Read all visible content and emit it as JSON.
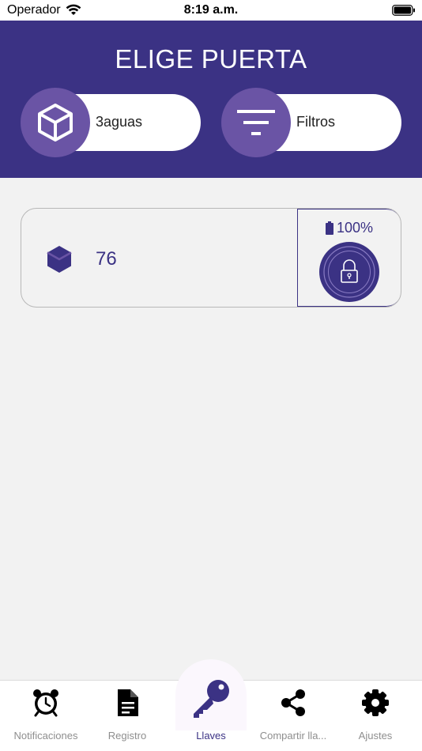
{
  "status_bar": {
    "carrier": "Operador",
    "time": "8:19 a.m."
  },
  "header": {
    "title": "ELIGE PUERTA",
    "door_selector": {
      "label": "3aguas",
      "icon": "cube-icon"
    },
    "filter_button": {
      "label": "Filtros",
      "icon": "filter-icon"
    }
  },
  "doors": [
    {
      "number": "76",
      "battery": "100%",
      "icon": "cube-icon",
      "lock_icon": "padlock-icon"
    }
  ],
  "tabs": [
    {
      "label": "Notificaciones",
      "icon": "alarm-clock-icon",
      "active": false
    },
    {
      "label": "Registro",
      "icon": "document-icon",
      "active": false
    },
    {
      "label": "Llaves",
      "icon": "key-icon",
      "active": true
    },
    {
      "label": "Compartir lla...",
      "icon": "share-icon",
      "active": false
    },
    {
      "label": "Ajustes",
      "icon": "gear-icon",
      "active": false
    }
  ],
  "colors": {
    "primary": "#3b3284",
    "secondary": "#6a54a5",
    "background": "#f2f2f2",
    "inactive_tab": "#8e8e8e"
  }
}
